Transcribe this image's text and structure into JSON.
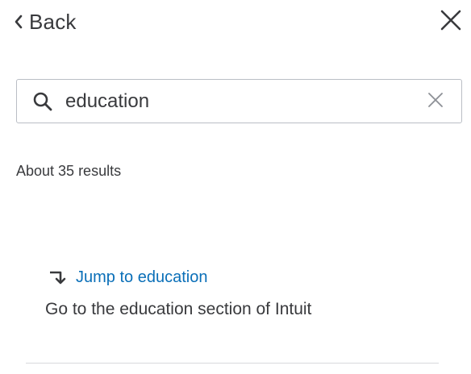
{
  "header": {
    "back_label": "Back",
    "back_icon": "chevron-left-icon",
    "close_icon": "close-icon"
  },
  "search": {
    "value": "education",
    "search_icon": "search-icon",
    "clear_icon": "clear-icon"
  },
  "results": {
    "count_text": "About 35 results",
    "items": [
      {
        "link_label": "Jump to education",
        "link_icon": "jump-arrow-icon",
        "description": "Go to the education section of Intuit"
      }
    ]
  },
  "colors": {
    "text": "#393a3d",
    "link": "#0a6fb8",
    "border": "#babec5",
    "divider": "#d8d9dc"
  }
}
